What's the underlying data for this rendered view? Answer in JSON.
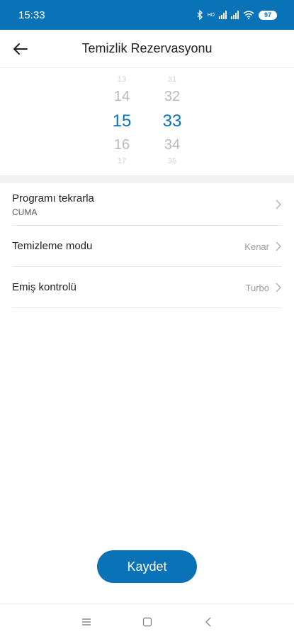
{
  "status_bar": {
    "time": "15:33",
    "network_label": "HD",
    "battery": "97"
  },
  "header": {
    "title": "Temizlik Rezervasyonu"
  },
  "time_picker": {
    "hours": {
      "far_prev": "13",
      "prev": "14",
      "selected": "15",
      "next": "16",
      "far_next": "17"
    },
    "minutes": {
      "far_prev": "31",
      "prev": "32",
      "selected": "33",
      "next": "34",
      "far_next": "35"
    }
  },
  "settings": {
    "repeat": {
      "label": "Programı tekrarla",
      "value": "CUMA"
    },
    "mode": {
      "label": "Temizleme modu",
      "value": "Kenar"
    },
    "suction": {
      "label": "Emiş kontrolü",
      "value": "Turbo"
    }
  },
  "actions": {
    "save_label": "Kaydet"
  },
  "colors": {
    "accent": "#0a73b8",
    "muted_text": "#b9b9b9"
  },
  "icons": [
    "bluetooth-icon",
    "signal-icon",
    "wifi-icon",
    "battery-icon",
    "back-arrow-icon",
    "chevron-right-icon",
    "menu-icon",
    "home-icon",
    "nav-back-icon"
  ]
}
